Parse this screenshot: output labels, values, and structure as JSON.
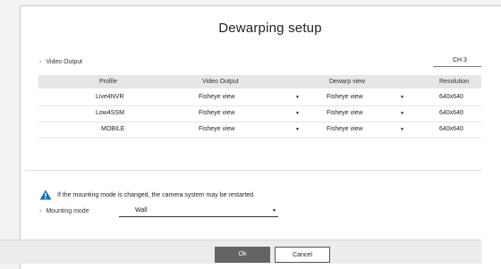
{
  "dialog": {
    "title": "Dewarping setup"
  },
  "video_output_section": {
    "label": "Video Output",
    "channel": "CH 3"
  },
  "table": {
    "headers": {
      "profile": "Profile",
      "video_output": "Video Output",
      "dewarp_view": "Dewarp view",
      "resolution": "Resolution"
    },
    "rows": [
      {
        "profile": "Live4NVR",
        "video_output": "Fisheye view",
        "dewarp_view": "Fisheye view",
        "resolution": "640x640"
      },
      {
        "profile": "Low4SSM",
        "video_output": "Fisheye view",
        "dewarp_view": "Fisheye view",
        "resolution": "640x640"
      },
      {
        "profile": "MOBILE",
        "video_output": "Fisheye view",
        "dewarp_view": "Fisheye view",
        "resolution": "640x640"
      }
    ]
  },
  "warning": {
    "text": "If the mounting mode is changed, the camera system may be restarted.",
    "icon": "warning-icon",
    "color": "#1e6fb8"
  },
  "mounting": {
    "label": "Mounting mode",
    "value": "Wall"
  },
  "buttons": {
    "ok": "Ok",
    "cancel": "Cancel"
  }
}
